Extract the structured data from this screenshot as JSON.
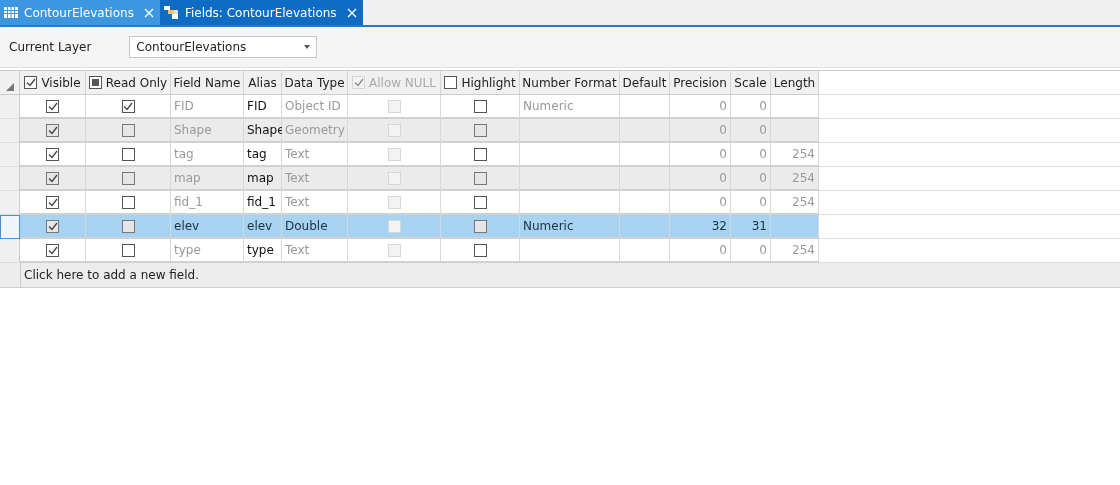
{
  "tabs": [
    {
      "label": "ContourElevations",
      "selected": false
    },
    {
      "label": "Fields:  ContourElevations",
      "selected": true
    }
  ],
  "layer_picker": {
    "label": "Current Layer",
    "value": "ContourElevations"
  },
  "table": {
    "columns": [
      {
        "label": "Visible",
        "kind": "checkbox",
        "checked": true,
        "disabled": false
      },
      {
        "label": "Read Only",
        "kind": "checkbox",
        "mixed": true,
        "disabled": false
      },
      {
        "label": "Field Name"
      },
      {
        "label": "Alias"
      },
      {
        "label": "Data Type"
      },
      {
        "label": "Allow NULL",
        "kind": "checkbox",
        "checked": true,
        "disabled": true
      },
      {
        "label": "Highlight",
        "kind": "checkbox",
        "checked": false,
        "disabled": false
      },
      {
        "label": "Number Format"
      },
      {
        "label": "Default"
      },
      {
        "label": "Precision"
      },
      {
        "label": "Scale"
      },
      {
        "label": "Length"
      }
    ],
    "rows": [
      {
        "visible": true,
        "read_only": true,
        "field_name": "FID",
        "alias": "FID",
        "data_type": "Object ID",
        "allow_null": false,
        "highlight": false,
        "number_format": "Numeric",
        "precision": "0",
        "scale": "0",
        "selected": false
      },
      {
        "visible": true,
        "read_only": false,
        "field_name": "Shape",
        "alias": "Shape",
        "data_type": "Geometry",
        "allow_null": false,
        "highlight": false,
        "precision": "0",
        "scale": "0",
        "selected": false
      },
      {
        "visible": true,
        "read_only": false,
        "field_name": "tag",
        "alias": "tag",
        "data_type": "Text",
        "allow_null": false,
        "highlight": false,
        "precision": "0",
        "scale": "0",
        "length": "254",
        "selected": false
      },
      {
        "visible": true,
        "read_only": false,
        "field_name": "map",
        "alias": "map",
        "data_type": "Text",
        "allow_null": false,
        "highlight": false,
        "precision": "0",
        "scale": "0",
        "length": "254",
        "selected": false
      },
      {
        "visible": true,
        "read_only": false,
        "field_name": "fid_1",
        "alias": "fid_1",
        "data_type": "Text",
        "allow_null": false,
        "highlight": false,
        "precision": "0",
        "scale": "0",
        "length": "254",
        "selected": false
      },
      {
        "visible": true,
        "read_only": false,
        "field_name": "elev",
        "alias": "elev",
        "data_type": "Double",
        "allow_null": false,
        "highlight": false,
        "number_format": "Numeric",
        "precision": "32",
        "scale": "31",
        "selected": true
      },
      {
        "visible": true,
        "read_only": false,
        "field_name": "type",
        "alias": "type",
        "data_type": "Text",
        "allow_null": false,
        "highlight": false,
        "precision": "0",
        "scale": "0",
        "length": "254",
        "selected": false
      }
    ],
    "add_row": "Click here to add a new field."
  }
}
